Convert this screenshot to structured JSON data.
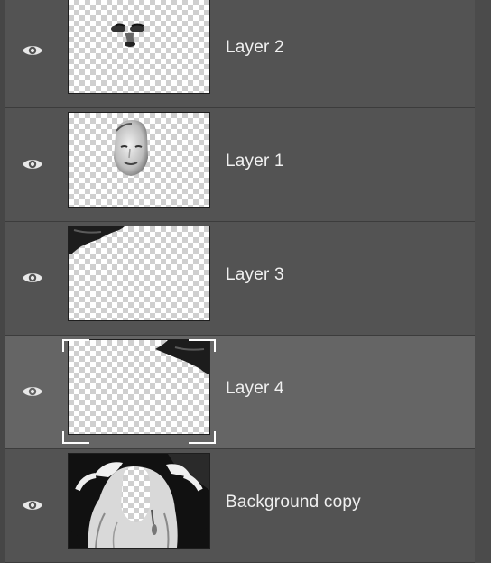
{
  "layers": [
    {
      "name": "Layer 2",
      "visible": true,
      "selected": false,
      "thumbnail": "face-eyes-nose"
    },
    {
      "name": "Layer 1",
      "visible": true,
      "selected": false,
      "thumbnail": "face-oval"
    },
    {
      "name": "Layer 3",
      "visible": true,
      "selected": false,
      "thumbnail": "dark-corner-top-left"
    },
    {
      "name": "Layer 4",
      "visible": true,
      "selected": true,
      "thumbnail": "dark-corner-top-right"
    },
    {
      "name": "Background copy",
      "visible": true,
      "selected": false,
      "thumbnail": "woman-hands-on-head"
    }
  ],
  "icons": {
    "visibility": "eye-icon"
  },
  "colors": {
    "panel": "#535353",
    "selected_row": "#656565",
    "text": "#f0f0f0"
  }
}
